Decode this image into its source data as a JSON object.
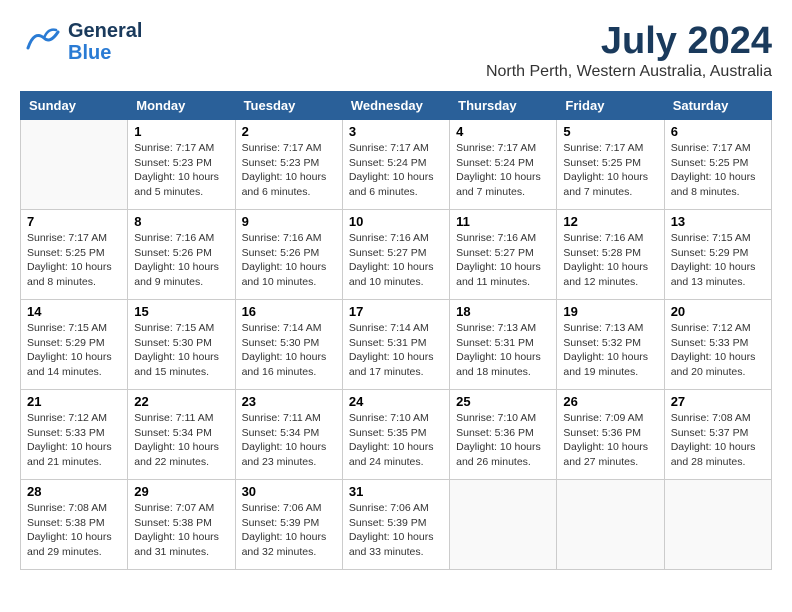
{
  "logo": {
    "general": "General",
    "blue": "Blue"
  },
  "title": "July 2024",
  "subtitle": "North Perth, Western Australia, Australia",
  "headers": [
    "Sunday",
    "Monday",
    "Tuesday",
    "Wednesday",
    "Thursday",
    "Friday",
    "Saturday"
  ],
  "weeks": [
    [
      {
        "day": "",
        "info": ""
      },
      {
        "day": "1",
        "info": "Sunrise: 7:17 AM\nSunset: 5:23 PM\nDaylight: 10 hours\nand 5 minutes."
      },
      {
        "day": "2",
        "info": "Sunrise: 7:17 AM\nSunset: 5:23 PM\nDaylight: 10 hours\nand 6 minutes."
      },
      {
        "day": "3",
        "info": "Sunrise: 7:17 AM\nSunset: 5:24 PM\nDaylight: 10 hours\nand 6 minutes."
      },
      {
        "day": "4",
        "info": "Sunrise: 7:17 AM\nSunset: 5:24 PM\nDaylight: 10 hours\nand 7 minutes."
      },
      {
        "day": "5",
        "info": "Sunrise: 7:17 AM\nSunset: 5:25 PM\nDaylight: 10 hours\nand 7 minutes."
      },
      {
        "day": "6",
        "info": "Sunrise: 7:17 AM\nSunset: 5:25 PM\nDaylight: 10 hours\nand 8 minutes."
      }
    ],
    [
      {
        "day": "7",
        "info": "Sunrise: 7:17 AM\nSunset: 5:25 PM\nDaylight: 10 hours\nand 8 minutes."
      },
      {
        "day": "8",
        "info": "Sunrise: 7:16 AM\nSunset: 5:26 PM\nDaylight: 10 hours\nand 9 minutes."
      },
      {
        "day": "9",
        "info": "Sunrise: 7:16 AM\nSunset: 5:26 PM\nDaylight: 10 hours\nand 10 minutes."
      },
      {
        "day": "10",
        "info": "Sunrise: 7:16 AM\nSunset: 5:27 PM\nDaylight: 10 hours\nand 10 minutes."
      },
      {
        "day": "11",
        "info": "Sunrise: 7:16 AM\nSunset: 5:27 PM\nDaylight: 10 hours\nand 11 minutes."
      },
      {
        "day": "12",
        "info": "Sunrise: 7:16 AM\nSunset: 5:28 PM\nDaylight: 10 hours\nand 12 minutes."
      },
      {
        "day": "13",
        "info": "Sunrise: 7:15 AM\nSunset: 5:29 PM\nDaylight: 10 hours\nand 13 minutes."
      }
    ],
    [
      {
        "day": "14",
        "info": "Sunrise: 7:15 AM\nSunset: 5:29 PM\nDaylight: 10 hours\nand 14 minutes."
      },
      {
        "day": "15",
        "info": "Sunrise: 7:15 AM\nSunset: 5:30 PM\nDaylight: 10 hours\nand 15 minutes."
      },
      {
        "day": "16",
        "info": "Sunrise: 7:14 AM\nSunset: 5:30 PM\nDaylight: 10 hours\nand 16 minutes."
      },
      {
        "day": "17",
        "info": "Sunrise: 7:14 AM\nSunset: 5:31 PM\nDaylight: 10 hours\nand 17 minutes."
      },
      {
        "day": "18",
        "info": "Sunrise: 7:13 AM\nSunset: 5:31 PM\nDaylight: 10 hours\nand 18 minutes."
      },
      {
        "day": "19",
        "info": "Sunrise: 7:13 AM\nSunset: 5:32 PM\nDaylight: 10 hours\nand 19 minutes."
      },
      {
        "day": "20",
        "info": "Sunrise: 7:12 AM\nSunset: 5:33 PM\nDaylight: 10 hours\nand 20 minutes."
      }
    ],
    [
      {
        "day": "21",
        "info": "Sunrise: 7:12 AM\nSunset: 5:33 PM\nDaylight: 10 hours\nand 21 minutes."
      },
      {
        "day": "22",
        "info": "Sunrise: 7:11 AM\nSunset: 5:34 PM\nDaylight: 10 hours\nand 22 minutes."
      },
      {
        "day": "23",
        "info": "Sunrise: 7:11 AM\nSunset: 5:34 PM\nDaylight: 10 hours\nand 23 minutes."
      },
      {
        "day": "24",
        "info": "Sunrise: 7:10 AM\nSunset: 5:35 PM\nDaylight: 10 hours\nand 24 minutes."
      },
      {
        "day": "25",
        "info": "Sunrise: 7:10 AM\nSunset: 5:36 PM\nDaylight: 10 hours\nand 26 minutes."
      },
      {
        "day": "26",
        "info": "Sunrise: 7:09 AM\nSunset: 5:36 PM\nDaylight: 10 hours\nand 27 minutes."
      },
      {
        "day": "27",
        "info": "Sunrise: 7:08 AM\nSunset: 5:37 PM\nDaylight: 10 hours\nand 28 minutes."
      }
    ],
    [
      {
        "day": "28",
        "info": "Sunrise: 7:08 AM\nSunset: 5:38 PM\nDaylight: 10 hours\nand 29 minutes."
      },
      {
        "day": "29",
        "info": "Sunrise: 7:07 AM\nSunset: 5:38 PM\nDaylight: 10 hours\nand 31 minutes."
      },
      {
        "day": "30",
        "info": "Sunrise: 7:06 AM\nSunset: 5:39 PM\nDaylight: 10 hours\nand 32 minutes."
      },
      {
        "day": "31",
        "info": "Sunrise: 7:06 AM\nSunset: 5:39 PM\nDaylight: 10 hours\nand 33 minutes."
      },
      {
        "day": "",
        "info": ""
      },
      {
        "day": "",
        "info": ""
      },
      {
        "day": "",
        "info": ""
      }
    ]
  ]
}
